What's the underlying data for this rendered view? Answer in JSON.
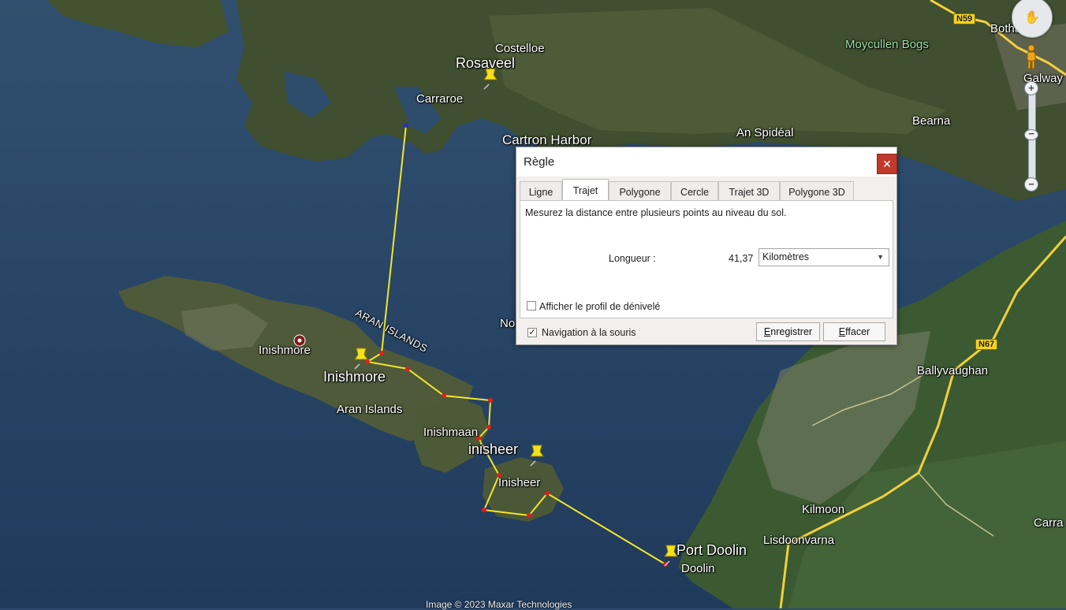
{
  "map": {
    "credit": "Image © 2023 Maxar Technologies",
    "places": {
      "costelloe": "Costelloe",
      "rosaveel": "Rosaveel",
      "carraroe": "Carraroe",
      "cartron_harbor": "Cartron Harbor",
      "an_spideal": "An Spidéal",
      "moycullen_bogs": "Moycullen Bogs",
      "bothar_na": "Bothar na",
      "galway": "Galway",
      "bearna": "Bearna",
      "inishmore_poi": "Inishmore",
      "inishmore": "Inishmore",
      "aran_islands_town": "Aran Islands",
      "aran_islands_region": "ARAN ISLANDS",
      "inishmaan": "Inishmaan",
      "inisheer_pin": "inisheer",
      "inisheer": "Inisheer",
      "port_doolin": "Port Doolin",
      "doolin": "Doolin",
      "kilmoon": "Kilmoon",
      "lisdoonvarna": "Lisdoonvarna",
      "ballyvaughan": "Ballyvaughan",
      "carra": "Carra",
      "no": "No"
    },
    "roads": {
      "n59": "N59",
      "n67": "N67"
    },
    "colors": {
      "route": "#f2e62a",
      "vertex": "#e01e1e",
      "pin": "#f5e11a",
      "sea": "#2c4a6e"
    }
  },
  "nav": {
    "zoom_in": "+",
    "zoom_out": "−"
  },
  "ruler": {
    "title": "Règle",
    "close": "✕",
    "tabs": [
      "Ligne",
      "Trajet",
      "Polygone",
      "Cercle",
      "Trajet 3D",
      "Polygone 3D"
    ],
    "active_tab": "Trajet",
    "description": "Mesurez la distance entre plusieurs points au niveau du sol.",
    "length_label": "Longueur :",
    "length_value": "41,37",
    "unit": "Kilomètres",
    "elevation_profile_label": "Afficher le profil de dénivelé",
    "elevation_profile_checked": false,
    "mouse_nav_label": "Navigation à la souris",
    "mouse_nav_checked": true,
    "save_label": "Enregistrer",
    "clear_label": "Effacer"
  }
}
